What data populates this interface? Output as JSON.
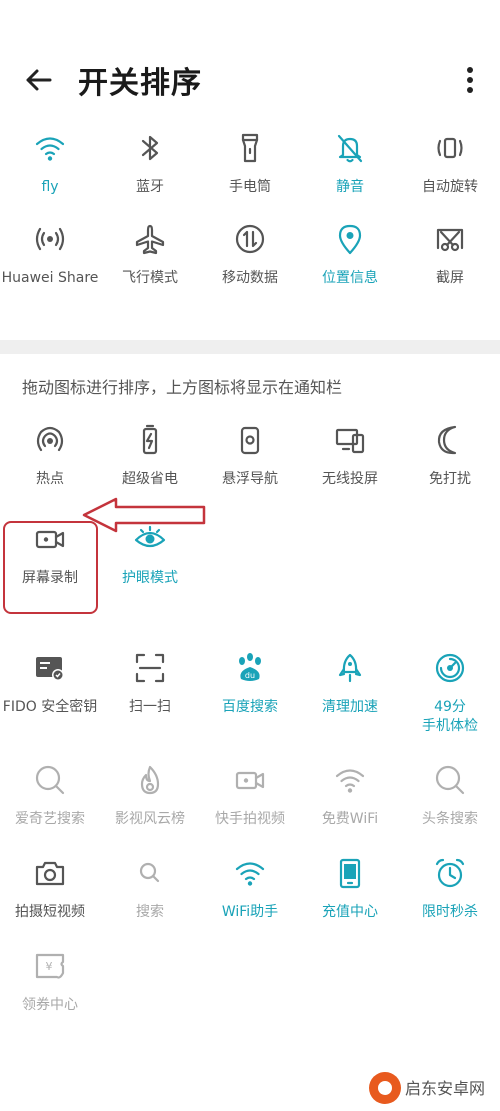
{
  "header": {
    "title": "开关排序",
    "back_icon": "back-arrow-icon",
    "more_icon": "more-vertical-icon"
  },
  "active_tiles": [
    {
      "label": "fly",
      "icon": "wifi-icon",
      "style": "blue"
    },
    {
      "label": "蓝牙",
      "icon": "bluetooth-icon",
      "style": "dark"
    },
    {
      "label": "手电筒",
      "icon": "flashlight-icon",
      "style": "dark"
    },
    {
      "label": "静音",
      "icon": "bell-off-icon",
      "style": "blue"
    },
    {
      "label": "自动旋转",
      "icon": "auto-rotate-icon",
      "style": "dark"
    },
    {
      "label": "Huawei Share",
      "icon": "huawei-share-icon",
      "style": "dark"
    },
    {
      "label": "飞行模式",
      "icon": "airplane-icon",
      "style": "dark"
    },
    {
      "label": "移动数据",
      "icon": "mobile-data-icon",
      "style": "dark"
    },
    {
      "label": "位置信息",
      "icon": "location-pin-icon",
      "style": "blue"
    },
    {
      "label": "截屏",
      "icon": "screenshot-icon",
      "style": "dark"
    }
  ],
  "hint": "拖动图标进行排序，上方图标将显示在通知栏",
  "inactive_tiles": [
    {
      "label": "热点",
      "icon": "hotspot-icon",
      "style": "dark"
    },
    {
      "label": "超级省电",
      "icon": "battery-saver-icon",
      "style": "dark"
    },
    {
      "label": "悬浮导航",
      "icon": "floating-nav-icon",
      "style": "dark"
    },
    {
      "label": "无线投屏",
      "icon": "wireless-projection-icon",
      "style": "dark"
    },
    {
      "label": "免打扰",
      "icon": "moon-icon",
      "style": "dark"
    },
    {
      "label": "屏幕录制",
      "icon": "screen-record-icon",
      "style": "dark"
    },
    {
      "label": "护眼模式",
      "icon": "eye-icon",
      "style": "blue"
    }
  ],
  "app_tiles": [
    {
      "label": "FIDO 安全密钥",
      "icon": "fido-card-icon",
      "style": "dark"
    },
    {
      "label": "扫一扫",
      "icon": "scan-icon",
      "style": "dark"
    },
    {
      "label": "百度搜索",
      "icon": "baidu-paw-icon",
      "style": "blue"
    },
    {
      "label": "清理加速",
      "icon": "rocket-icon",
      "style": "blue"
    },
    {
      "label": "49分\n手机体检",
      "icon": "checkup-gauge-icon",
      "style": "blue"
    },
    {
      "label": "爱奇艺搜索",
      "icon": "search-icon",
      "style": "light"
    },
    {
      "label": "影视风云榜",
      "icon": "flame-icon",
      "style": "light"
    },
    {
      "label": "快手拍视频",
      "icon": "video-camera-icon",
      "style": "light"
    },
    {
      "label": "免费WiFi",
      "icon": "wifi-gray-icon",
      "style": "light"
    },
    {
      "label": "头条搜索",
      "icon": "search-gray-icon",
      "style": "light"
    },
    {
      "label": "拍摄短视频",
      "icon": "camera-icon",
      "style": "dark"
    },
    {
      "label": "搜索",
      "icon": "search-small-icon",
      "style": "light"
    },
    {
      "label": "WiFi助手",
      "icon": "wifi-assistant-icon",
      "style": "blue"
    },
    {
      "label": "充值中心",
      "icon": "recharge-phone-icon",
      "style": "blue"
    },
    {
      "label": "限时秒杀",
      "icon": "alarm-clock-icon",
      "style": "blue"
    },
    {
      "label": "领券中心",
      "icon": "coupon-icon",
      "style": "light"
    }
  ],
  "watermark": "启东安卓网",
  "colors": {
    "accent": "#1aa3b8",
    "dark_icon": "#555555",
    "light_icon": "#b0b0b0",
    "annotation": "#c4343c"
  }
}
